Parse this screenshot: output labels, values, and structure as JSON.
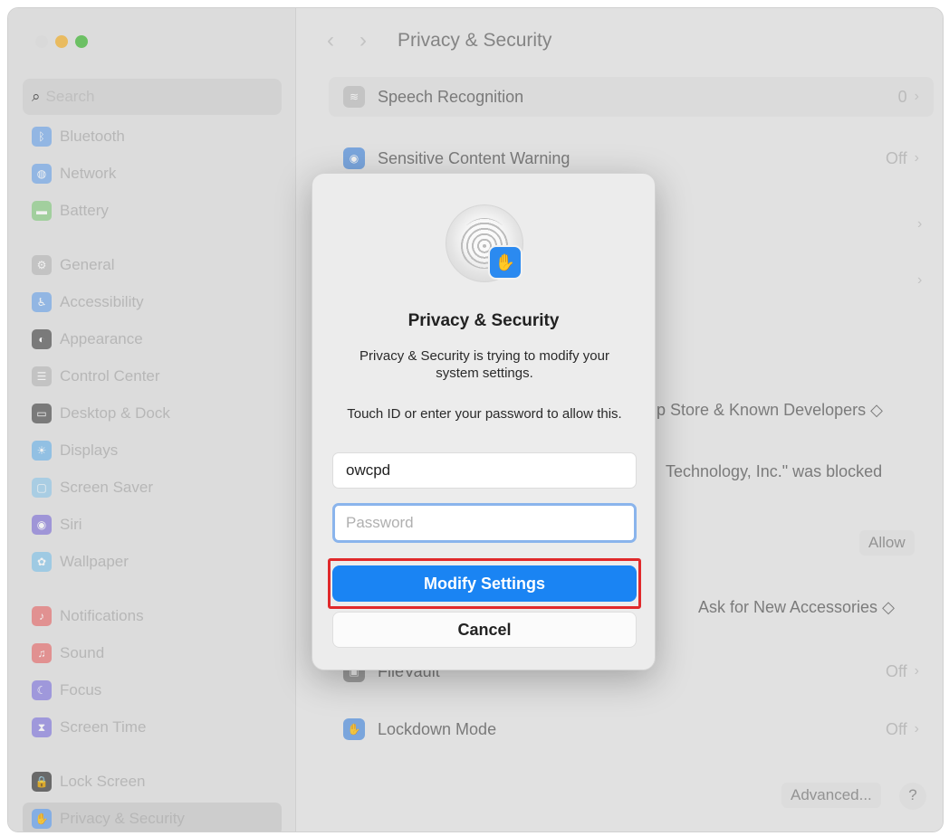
{
  "window": {
    "title": "Privacy & Security"
  },
  "sidebar": {
    "search_placeholder": "Search",
    "items": [
      {
        "label": "Bluetooth",
        "icon": "bluetooth-icon",
        "color": "#8cb8ee"
      },
      {
        "label": "Network",
        "icon": "globe-icon",
        "color": "#8cb8ee"
      },
      {
        "label": "Battery",
        "icon": "battery-icon",
        "color": "#9fd69a"
      },
      {
        "label": "General",
        "icon": "gear-icon",
        "color": "#c7c7c7"
      },
      {
        "label": "Accessibility",
        "icon": "accessibility-icon",
        "color": "#8cb8ee"
      },
      {
        "label": "Appearance",
        "icon": "appearance-icon",
        "color": "#6e6e6e"
      },
      {
        "label": "Control Center",
        "icon": "control-center-icon",
        "color": "#c7c7c7"
      },
      {
        "label": "Desktop & Dock",
        "icon": "dock-icon",
        "color": "#6e6e6e"
      },
      {
        "label": "Displays",
        "icon": "sun-icon",
        "color": "#8cc4ee"
      },
      {
        "label": "Screen Saver",
        "icon": "screen-saver-icon",
        "color": "#a8d4ee"
      },
      {
        "label": "Siri",
        "icon": "siri-icon",
        "color": "#9b8fe0"
      },
      {
        "label": "Wallpaper",
        "icon": "flower-icon",
        "color": "#9cd0ee"
      },
      {
        "label": "Notifications",
        "icon": "bell-icon",
        "color": "#ec8a8a"
      },
      {
        "label": "Sound",
        "icon": "speaker-icon",
        "color": "#ec8a8a"
      },
      {
        "label": "Focus",
        "icon": "moon-icon",
        "color": "#9b93e4"
      },
      {
        "label": "Screen Time",
        "icon": "hourglass-icon",
        "color": "#9b93e4"
      },
      {
        "label": "Lock Screen",
        "icon": "lock-icon",
        "color": "#5a5a5a"
      },
      {
        "label": "Privacy & Security",
        "icon": "hand-icon",
        "color": "#7aaef0"
      }
    ]
  },
  "rows": {
    "speech": {
      "label": "Speech Recognition",
      "value": "0"
    },
    "sensitive": {
      "label": "Sensitive Content Warning",
      "value": "Off"
    },
    "app_store": "p Store & Known Developers",
    "blocked": "Technology, Inc.\" was blocked",
    "allow": "Allow",
    "accessories": "Ask for New Accessories",
    "filevault": {
      "label": "FileVault",
      "value": "Off"
    },
    "lockdown": {
      "label": "Lockdown Mode",
      "value": "Off"
    },
    "advanced": "Advanced...",
    "help": "?"
  },
  "dialog": {
    "title": "Privacy & Security",
    "message1": "Privacy & Security is trying to modify your system settings.",
    "message2": "Touch ID or enter your password to allow this.",
    "username": "owcpd",
    "password_placeholder": "Password",
    "primary_label": "Modify Settings",
    "cancel_label": "Cancel"
  }
}
